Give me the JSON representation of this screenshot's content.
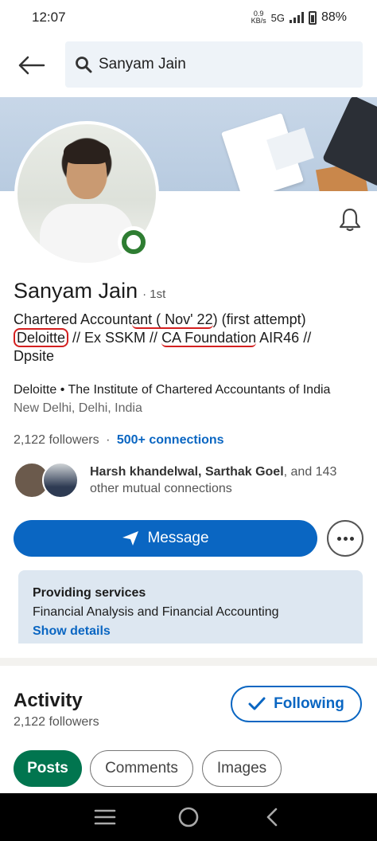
{
  "status_bar": {
    "time": "12:07",
    "data_speed_value": "0.9",
    "data_speed_unit": "KB/s",
    "network": "5G",
    "battery": "88%"
  },
  "search": {
    "query": "Sanyam Jain"
  },
  "profile": {
    "name": "Sanyam Jain",
    "degree": "· 1st",
    "headline_parts": {
      "a": "Chartered Account",
      "b": "ant ( Nov' 22",
      "c": ") (first attempt)",
      "d": "Deloitte",
      "e": " // Ex SSKM // ",
      "f": "CA Foundation",
      "g": " AIR46 //",
      "h": "Dpsite"
    },
    "company": "Deloitte • The Institute of Chartered Accountants of India",
    "location": "New Delhi, Delhi, India",
    "followers": "2,122 followers",
    "separator": "·",
    "connections": "500+ connections",
    "mutual": {
      "names": "Harsh khandelwal, Sarthak Goel",
      "rest": ", and 143 other mutual connections"
    }
  },
  "actions": {
    "message_label": "Message"
  },
  "services": {
    "title": "Providing services",
    "description": "Financial Analysis and Financial Accounting",
    "link": "Show details"
  },
  "activity": {
    "title": "Activity",
    "followers": "2,122 followers",
    "following_label": "Following",
    "tabs": [
      "Posts",
      "Comments",
      "Images"
    ]
  },
  "colors": {
    "accent": "#0a66c2",
    "active_tab": "#01754f",
    "online": "#2e7d32"
  }
}
